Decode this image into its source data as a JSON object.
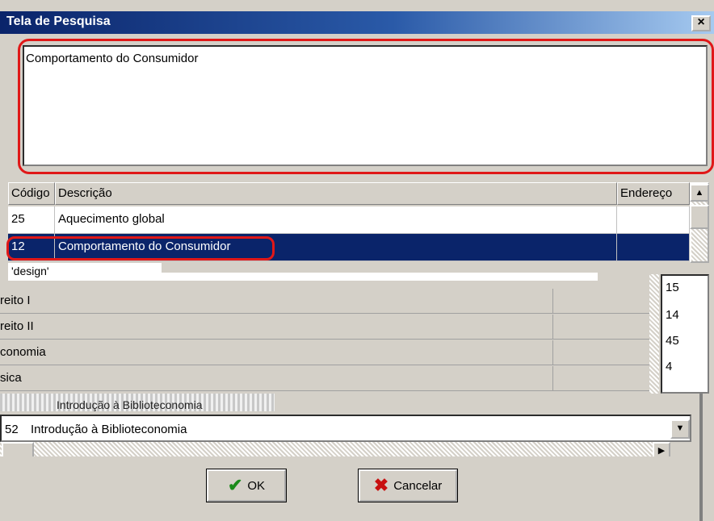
{
  "window": {
    "title": "Tela de Pesquisa",
    "close_label": "×"
  },
  "search": {
    "value": "Comportamento do Consumidor"
  },
  "grid": {
    "columns": [
      "Código",
      "Descrição",
      "Endereço"
    ],
    "rows": [
      {
        "code": "25",
        "description": "Aquecimento global",
        "address": ""
      },
      {
        "code": "12",
        "description": "Comportamento do Consumidor",
        "address": "",
        "selected": true
      }
    ],
    "partial_row": "'design'"
  },
  "background_list": {
    "items": [
      "reito I",
      "reito II",
      "conomia",
      "sica"
    ],
    "numbers": [
      "15",
      "14",
      "45",
      "4"
    ],
    "garbled_text": "Introdução à Biblioteconomia"
  },
  "dropdown": {
    "code": "52",
    "value": "Introdução à Biblioteconomia"
  },
  "buttons": {
    "ok": "OK",
    "cancel": "Cancelar"
  },
  "colors": {
    "selection": "#0a246a",
    "highlight_outline": "#e01818",
    "title_bar": "#0a246a"
  }
}
